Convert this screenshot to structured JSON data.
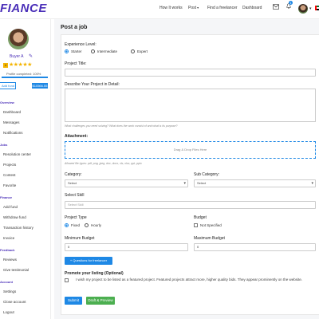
{
  "header": {
    "logo": "FIANCE",
    "nav": {
      "how_it_works": "How It works",
      "post": "Post",
      "find_freelancer": "Find a freelancer",
      "dashboard": "Dashboard"
    },
    "notification_count": "1",
    "icons": [
      "mail-icon",
      "bell-icon",
      "avatar",
      "chevron-down-icon",
      "uae-flag-icon"
    ]
  },
  "sidebar": {
    "name": "Buyer A",
    "rating_badge": "4",
    "stars": "★★★★★",
    "rating_value": 4,
    "profile_completed": "Profile completed: 100%",
    "profile_progress": 100,
    "add_fund": "Add fund",
    "balance": "$10566.55",
    "sections": [
      {
        "title": "Overview",
        "items": [
          "Dashboard",
          "Messages",
          "Notifications"
        ]
      },
      {
        "title": "Jobs",
        "items": [
          "Resolution center",
          "Projects",
          "Contest",
          "Favorite"
        ]
      },
      {
        "title": "Finance",
        "items": [
          "Add fund",
          "Withdraw fund",
          "Transaction history",
          "Invoice"
        ]
      },
      {
        "title": "Feedback",
        "items": [
          "Reviews",
          "Give testimonial"
        ]
      },
      {
        "title": "Account",
        "items": [
          "Settings",
          "Close account",
          "Logout"
        ]
      }
    ]
  },
  "main": {
    "title": "Post a job",
    "experience": {
      "label": "Experience Level:",
      "options": [
        "Starter",
        "Intermediate",
        "Expert"
      ],
      "selected": "Starter"
    },
    "project_title": {
      "label": "Project Title:",
      "value": ""
    },
    "description": {
      "label": "Describe Your Project in Detail:",
      "hint": "What challenges you need solving? What does the work consist of and what is its purpose?"
    },
    "attachment": {
      "label": "Attachment:",
      "dropzone": "Drag & Drop Files Here",
      "hint": "Allowed file types: pdf, png, jpeg, doc, docx, xls, xlsx, ppt, pptx"
    },
    "category": {
      "label": "Category:",
      "value": "Select"
    },
    "sub_category": {
      "label": "Sub Category:",
      "value": "Select"
    },
    "skill": {
      "label": "Select Skill",
      "placeholder": "Select Skill"
    },
    "project_type": {
      "label": "Project Type",
      "options": [
        "Fixed",
        "Hourly"
      ],
      "selected": "Fixed"
    },
    "budget": {
      "label": "Budget",
      "not_specified": "Not Specified"
    },
    "min_budget": {
      "label": "Minimum Budget",
      "value": "0"
    },
    "max_budget": {
      "label": "Maximum Budget",
      "value": "0"
    },
    "questions_button": "+ Questions for freelancer",
    "promote": {
      "label": "Promote your listing (Optional)",
      "text": "I wish my project to be listed as a featured project. Featured projects attract more, higher quality bids. They appear prominently on the website."
    },
    "submit": "Submit",
    "draft": "Draft & Preview"
  },
  "colors": {
    "brand": "#4a2fb8",
    "accent": "#1e88e5",
    "success": "#4caf50",
    "star": "#f4b400"
  }
}
